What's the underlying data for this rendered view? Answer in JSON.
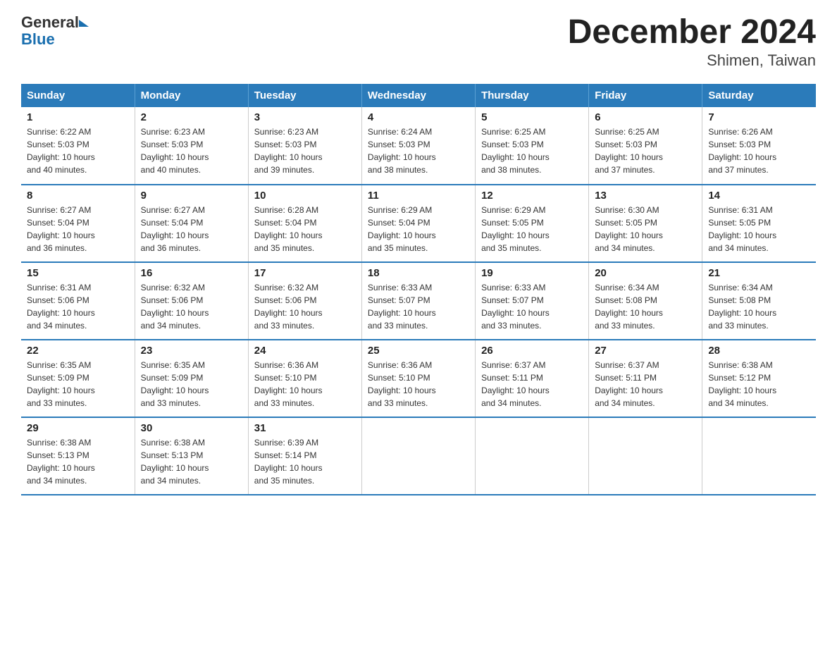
{
  "header": {
    "logo_line1": "General",
    "logo_line2": "Blue",
    "title": "December 2024",
    "subtitle": "Shimen, Taiwan"
  },
  "weekdays": [
    "Sunday",
    "Monday",
    "Tuesday",
    "Wednesday",
    "Thursday",
    "Friday",
    "Saturday"
  ],
  "weeks": [
    [
      {
        "day": "1",
        "sunrise": "6:22 AM",
        "sunset": "5:03 PM",
        "daylight": "10 hours and 40 minutes."
      },
      {
        "day": "2",
        "sunrise": "6:23 AM",
        "sunset": "5:03 PM",
        "daylight": "10 hours and 40 minutes."
      },
      {
        "day": "3",
        "sunrise": "6:23 AM",
        "sunset": "5:03 PM",
        "daylight": "10 hours and 39 minutes."
      },
      {
        "day": "4",
        "sunrise": "6:24 AM",
        "sunset": "5:03 PM",
        "daylight": "10 hours and 38 minutes."
      },
      {
        "day": "5",
        "sunrise": "6:25 AM",
        "sunset": "5:03 PM",
        "daylight": "10 hours and 38 minutes."
      },
      {
        "day": "6",
        "sunrise": "6:25 AM",
        "sunset": "5:03 PM",
        "daylight": "10 hours and 37 minutes."
      },
      {
        "day": "7",
        "sunrise": "6:26 AM",
        "sunset": "5:03 PM",
        "daylight": "10 hours and 37 minutes."
      }
    ],
    [
      {
        "day": "8",
        "sunrise": "6:27 AM",
        "sunset": "5:04 PM",
        "daylight": "10 hours and 36 minutes."
      },
      {
        "day": "9",
        "sunrise": "6:27 AM",
        "sunset": "5:04 PM",
        "daylight": "10 hours and 36 minutes."
      },
      {
        "day": "10",
        "sunrise": "6:28 AM",
        "sunset": "5:04 PM",
        "daylight": "10 hours and 35 minutes."
      },
      {
        "day": "11",
        "sunrise": "6:29 AM",
        "sunset": "5:04 PM",
        "daylight": "10 hours and 35 minutes."
      },
      {
        "day": "12",
        "sunrise": "6:29 AM",
        "sunset": "5:05 PM",
        "daylight": "10 hours and 35 minutes."
      },
      {
        "day": "13",
        "sunrise": "6:30 AM",
        "sunset": "5:05 PM",
        "daylight": "10 hours and 34 minutes."
      },
      {
        "day": "14",
        "sunrise": "6:31 AM",
        "sunset": "5:05 PM",
        "daylight": "10 hours and 34 minutes."
      }
    ],
    [
      {
        "day": "15",
        "sunrise": "6:31 AM",
        "sunset": "5:06 PM",
        "daylight": "10 hours and 34 minutes."
      },
      {
        "day": "16",
        "sunrise": "6:32 AM",
        "sunset": "5:06 PM",
        "daylight": "10 hours and 34 minutes."
      },
      {
        "day": "17",
        "sunrise": "6:32 AM",
        "sunset": "5:06 PM",
        "daylight": "10 hours and 33 minutes."
      },
      {
        "day": "18",
        "sunrise": "6:33 AM",
        "sunset": "5:07 PM",
        "daylight": "10 hours and 33 minutes."
      },
      {
        "day": "19",
        "sunrise": "6:33 AM",
        "sunset": "5:07 PM",
        "daylight": "10 hours and 33 minutes."
      },
      {
        "day": "20",
        "sunrise": "6:34 AM",
        "sunset": "5:08 PM",
        "daylight": "10 hours and 33 minutes."
      },
      {
        "day": "21",
        "sunrise": "6:34 AM",
        "sunset": "5:08 PM",
        "daylight": "10 hours and 33 minutes."
      }
    ],
    [
      {
        "day": "22",
        "sunrise": "6:35 AM",
        "sunset": "5:09 PM",
        "daylight": "10 hours and 33 minutes."
      },
      {
        "day": "23",
        "sunrise": "6:35 AM",
        "sunset": "5:09 PM",
        "daylight": "10 hours and 33 minutes."
      },
      {
        "day": "24",
        "sunrise": "6:36 AM",
        "sunset": "5:10 PM",
        "daylight": "10 hours and 33 minutes."
      },
      {
        "day": "25",
        "sunrise": "6:36 AM",
        "sunset": "5:10 PM",
        "daylight": "10 hours and 33 minutes."
      },
      {
        "day": "26",
        "sunrise": "6:37 AM",
        "sunset": "5:11 PM",
        "daylight": "10 hours and 34 minutes."
      },
      {
        "day": "27",
        "sunrise": "6:37 AM",
        "sunset": "5:11 PM",
        "daylight": "10 hours and 34 minutes."
      },
      {
        "day": "28",
        "sunrise": "6:38 AM",
        "sunset": "5:12 PM",
        "daylight": "10 hours and 34 minutes."
      }
    ],
    [
      {
        "day": "29",
        "sunrise": "6:38 AM",
        "sunset": "5:13 PM",
        "daylight": "10 hours and 34 minutes."
      },
      {
        "day": "30",
        "sunrise": "6:38 AM",
        "sunset": "5:13 PM",
        "daylight": "10 hours and 34 minutes."
      },
      {
        "day": "31",
        "sunrise": "6:39 AM",
        "sunset": "5:14 PM",
        "daylight": "10 hours and 35 minutes."
      },
      null,
      null,
      null,
      null
    ]
  ],
  "labels": {
    "sunrise": "Sunrise:",
    "sunset": "Sunset:",
    "daylight": "Daylight:"
  }
}
